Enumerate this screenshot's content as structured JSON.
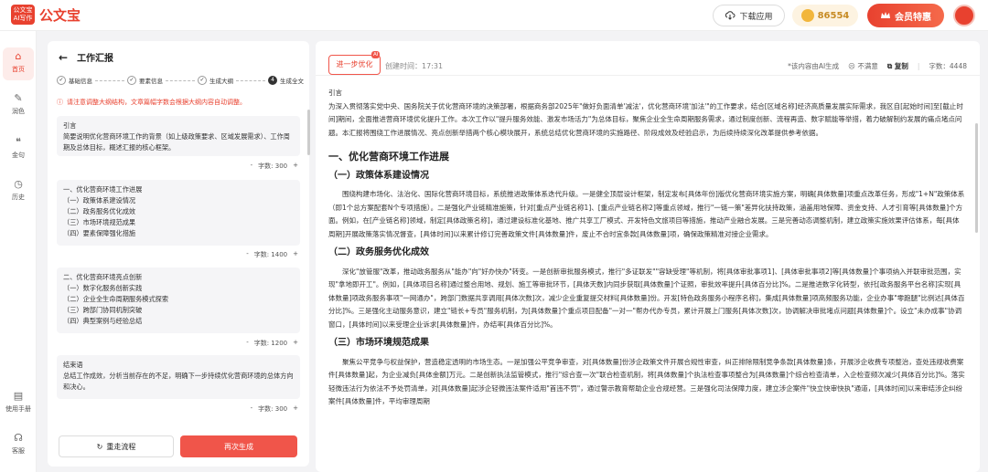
{
  "header": {
    "logo_mark_line1": "公文宝",
    "logo_mark_line2": "AI写作",
    "logo_text": "公文宝",
    "download_label": "下载应用",
    "coin_count": "86554",
    "vip_label": "会员特惠"
  },
  "leftnav": {
    "items": [
      {
        "label": "首页",
        "icon": "home-icon"
      },
      {
        "label": "润色",
        "icon": "polish-icon"
      },
      {
        "label": "金句",
        "icon": "quote-icon"
      },
      {
        "label": "历史",
        "icon": "history-icon"
      },
      {
        "label": "使用手册",
        "icon": "manual-icon"
      },
      {
        "label": "客服",
        "icon": "headset-icon"
      }
    ]
  },
  "outline": {
    "title": "工作汇报",
    "steps": [
      {
        "label": "基础信息",
        "num": "✓"
      },
      {
        "label": "要素信息",
        "num": "✓"
      },
      {
        "label": "生成大纲",
        "num": "✓"
      },
      {
        "label": "生成全文",
        "num": "4"
      }
    ],
    "notice": "请注意调整大纲结构，文章篇幅字数会根据大纲内容自动调整。",
    "sections": [
      {
        "title": "引言",
        "lines": [
          "简要说明优化营商环境工作的背景（如上级政策要求、区域发展需求）、工作周期及总体目标，概述汇报的核心框架。"
        ],
        "count": "字数: 300"
      },
      {
        "title": "一、优化营商环境工作进展",
        "lines": [
          "（一）政策体系建设情况",
          "（二）政务服务优化成效",
          "（三）市场环境规范成果",
          "（四）要素保障强化措施"
        ],
        "count": "字数: 1400"
      },
      {
        "title": "二、优化营商环境亮点创新",
        "lines": [
          "（一）数字化服务创新实践",
          "（二）企业全生命周期服务模式探索",
          "（三）跨部门协同机制突破",
          "（四）典型案例与经验总结"
        ],
        "count": "字数: 1200"
      },
      {
        "title": "结束语",
        "lines": [
          "总结工作成效，分析当前存在的不足，明确下一步持续优化营商环境的总体方向和决心。"
        ],
        "count": "字数: 300"
      }
    ],
    "reset_label": "重走流程",
    "regen_label": "再次生成"
  },
  "doc": {
    "optimize_label": "进一步优化",
    "ai_badge": "AI",
    "created_time": "创建时间：17:31",
    "ai_note": "*该内容由AI生成",
    "dislike_label": "不满意",
    "copy_label": "复制",
    "word_count": "字数：4448",
    "intro_title": "引言",
    "intro_text": "为深入贯彻落实党中央、国务院关于优化营商环境的决策部署，根据商务部2025年\"做好负面清单'减法'，优化营商环境'加法'\"的工作要求，结合[区域名称]经济高质量发展实际需求，我区自[起始时间]至[截止时间]期间，全面推进营商环境优化提升工作。本次工作以\"提升服务效能、激发市场活力\"为总体目标，聚焦企业全生命周期服务需求，通过制度创新、流程再造、数字赋能等举措，着力破解制约发展的痛点堵点问题。本汇报将围绕工作进展情况、亮点创新举措两个核心模块展开，系统总结优化营商环境的实施路径、阶段成效及经验启示，为后续持续深化改革提供参考依据。",
    "section1_title": "一、优化营商环境工作进展",
    "sub1_title": "（一）政策体系建设情况",
    "sub1_text": "围绕构建市场化、法治化、国际化营商环境目标，系统推进政策体系迭代升级。一是健全顶层设计框架，制定发布[具体年份]版优化营商环境实施方案，明确[具体数量]项重点改革任务，形成\"1+N\"政策体系（即1个总方案配套N个专项措施）。二是强化产业链精准施策，针对[重点产业链名称1]、[重点产业链名称2]等重点领域，推行\"一链一策\"差异化扶持政策，涵盖用地保障、资金支持、人才引育等[具体数量]个方面。例如，在[产业链名称]领域，制定[具体政策名称]，通过建设标准化基地、推广共享工厂模式、开发特色文旅项目等措施，推动产业融合发展。三是完善动态调整机制，建立政策实施效果评估体系，每[具体周期]开展政策落实情况督查，[具体时间]以来累计修订完善政策文件[具体数量]件，废止不合时宜条款[具体数量]项，确保政策精准对接企业需求。",
    "sub2_title": "（二）政务服务优化成效",
    "sub2_text": "深化\"放管服\"改革，推动政务服务从\"能办\"向\"好办快办\"转变。一是创新审批服务模式，推行\"多证联发\"\"容缺受理\"等机制，将[具体审批事项1]、[具体审批事项2]等[具体数量]个事项纳入并联审批范围，实现\"拿地即开工\"。例如，[具体项目名称]通过整合用地、规划、施工等审批环节，[具体天数]内同步获取[具体数量]个证照，审批效率提升[具体百分比]%。二是推进数字化转型，依托[政务服务平台名称]实现[具体数量]项政务服务事项\"一网通办\"，跨部门数据共享调用[具体次数]次，减少企业重复提交材料[具体数量]份。开发[特色政务服务小程序名称]，集成[具体数量]项高频服务功能，企业办事\"零跑腿\"比例达[具体百分比]%。三是强化主动服务意识，建立\"链长+专员\"服务机制，为[具体数量]个重点项目配备\"一对一\"帮办代办专员，累计开展上门服务[具体次数]次，协调解决审批堵点问题[具体数量]个。设立\"未办成事\"协调窗口，[具体时间]以来受理企业诉求[具体数量]件，办结率[具体百分比]%。",
    "sub3_title": "（三）市场环境规范成果",
    "sub3_text": "聚焦公平竞争与权益保护，营造稳定透明的市场生态。一是加强公平竞争审查，对[具体数量]份涉企政策文件开展合规性审查，纠正排除限制竞争条款[具体数量]条，开展涉企收费专项整治，查处违规收费案件[具体数量]起，为企业减负[具体金额]万元。二是创新执法监管模式，推行\"综合查一次\"联合检查机制，将[具体数量]个执法检查事项整合为[具体数量]个综合检查清单，入企检查频次减少[具体百分比]%。落实轻微违法行为依法不予处罚清单，对[具体数量]起涉企轻微违法案件适用\"首违不罚\"，通过警示教育帮助企业合规经营。三是强化司法保障力度，建立涉企案件\"快立快审快执\"通道，[具体时间]以来审结涉企纠纷案件[具体数量]件，平均审理周期"
  }
}
